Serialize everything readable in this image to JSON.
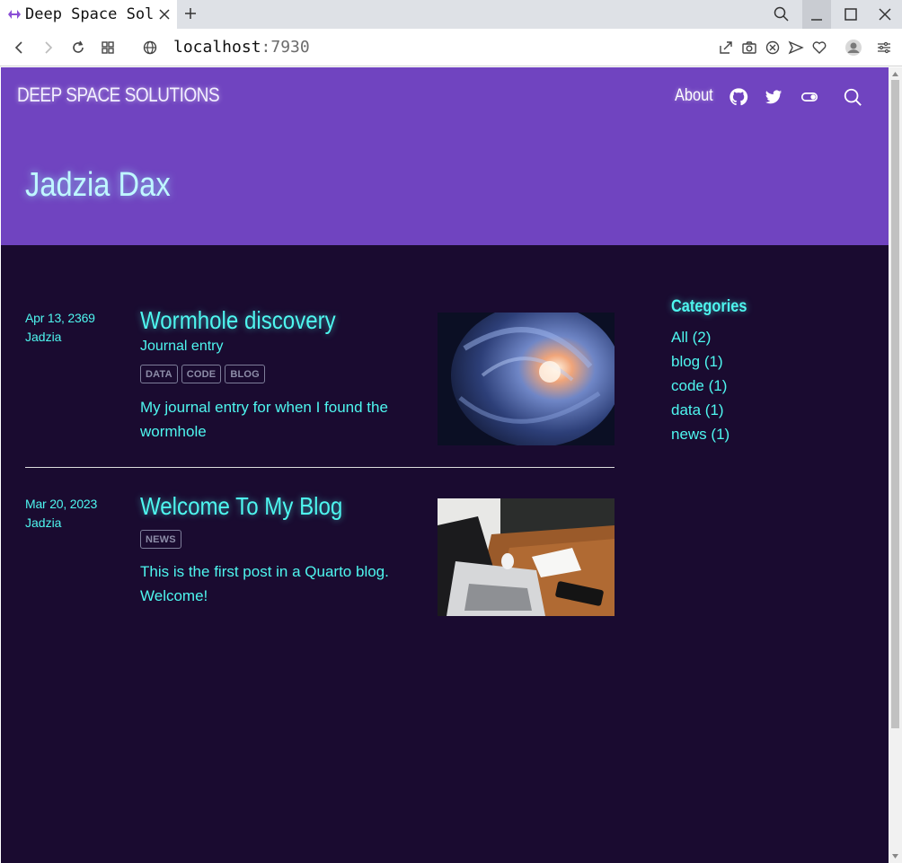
{
  "browser": {
    "tab_title": "Deep Space Solutions",
    "url_host": "localhost",
    "url_port": ":7930"
  },
  "site": {
    "brand": "DEEP SPACE SOLUTIONS",
    "nav": {
      "about_label": "About",
      "icons": [
        "github-icon",
        "twitter-icon",
        "toggle-icon",
        "search-icon"
      ]
    },
    "page_title": "Jadzia Dax"
  },
  "posts": [
    {
      "date": "Apr 13, 2369",
      "author": "Jadzia",
      "title": "Wormhole discovery",
      "subtitle": "Journal entry",
      "tags": [
        "DATA",
        "CODE",
        "BLOG"
      ],
      "description": "My journal entry for when I found the wormhole",
      "thumbnail": "wormhole-image"
    },
    {
      "date": "Mar 20, 2023",
      "author": "Jadzia",
      "title": "Welcome To My Blog",
      "subtitle": "",
      "tags": [
        "NEWS"
      ],
      "description": "This is the first post in a Quarto blog. Welcome!",
      "thumbnail": "desk-laptop-image"
    }
  ],
  "categories": {
    "title": "Categories",
    "items": [
      "All (2)",
      "blog (1)",
      "code (1)",
      "data (1)",
      "news (1)"
    ]
  },
  "colors": {
    "navbar": "#7044c0",
    "background": "#1a0b30",
    "accent": "#4ef6ef",
    "tag_border": "#7e7e9a"
  }
}
